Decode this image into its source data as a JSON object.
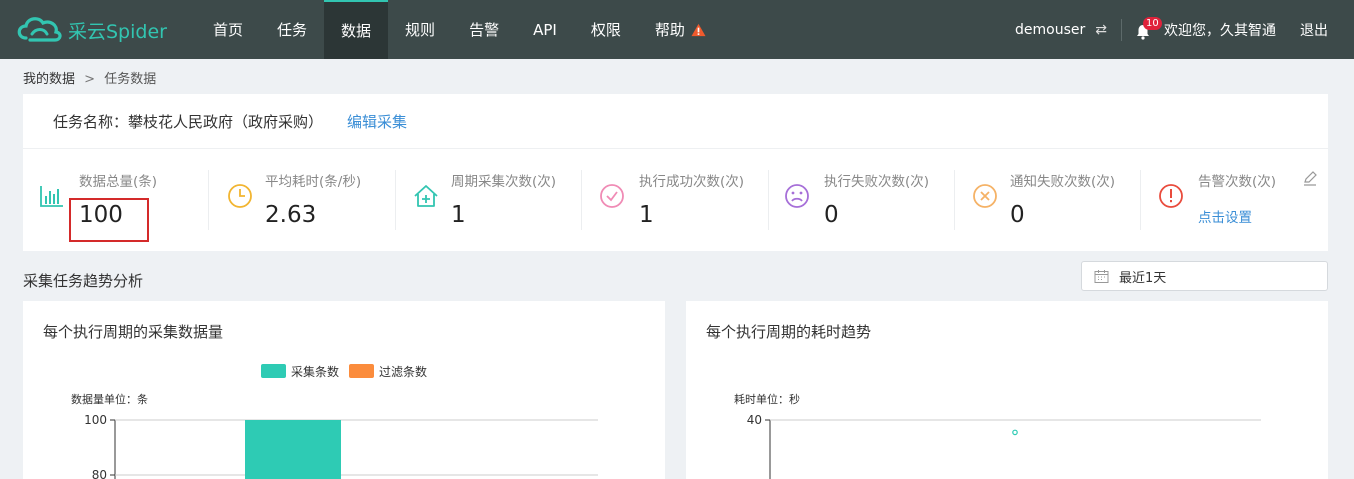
{
  "app": {
    "brand": "采云Spider",
    "colors": {
      "nav_bg": "#3d4a4a",
      "accent": "#32c5b1",
      "link": "#3a8ed6",
      "alert": "#e0223b",
      "warn": "#ef5a2d"
    }
  },
  "nav": {
    "items": [
      {
        "label": "首页",
        "active": false
      },
      {
        "label": "任务",
        "active": false
      },
      {
        "label": "数据",
        "active": true
      },
      {
        "label": "规则",
        "active": false
      },
      {
        "label": "告警",
        "active": false
      },
      {
        "label": "API",
        "active": false
      },
      {
        "label": "权限",
        "active": false
      },
      {
        "label": "帮助",
        "active": false,
        "icon": "warning-icon"
      }
    ]
  },
  "header_right": {
    "username": "demouser",
    "switch_icon": "⇄",
    "notification_count": "10",
    "welcome": "欢迎您，久其智通",
    "logout": "退出"
  },
  "breadcrumb": {
    "parent": "我的数据",
    "separator": ">",
    "current": "任务数据"
  },
  "task": {
    "name_label": "任务名称：攀枝花人民政府（政府采购）",
    "edit_label": "编辑采集"
  },
  "stats": [
    {
      "label": "数据总量(条)",
      "value": "100",
      "icon": "bar-chart-icon",
      "color": "#32c5b1"
    },
    {
      "label": "平均耗时(条/秒)",
      "value": "2.63",
      "icon": "clock-icon",
      "color": "#f2b531"
    },
    {
      "label": "周期采集次数(次)",
      "value": "1",
      "icon": "house-plus-icon",
      "color": "#32c5b1"
    },
    {
      "label": "执行成功次数(次)",
      "value": "1",
      "icon": "check-circle-icon",
      "color": "#f08bb5"
    },
    {
      "label": "执行失败次数(次)",
      "value": "0",
      "icon": "sad-face-icon",
      "color": "#a66fd8"
    },
    {
      "label": "通知失败次数(次)",
      "value": "0",
      "icon": "x-circle-icon",
      "color": "#f5b266"
    },
    {
      "label": "告警次数(次)",
      "value": "",
      "link": "点击设置",
      "icon": "alert-circle-icon",
      "color": "#e94b3c"
    }
  ],
  "trend": {
    "section_title": "采集任务趋势分析",
    "date_range": "最近1天"
  },
  "chart_data": [
    {
      "type": "bar",
      "title": "每个执行周期的采集数据量",
      "ylabel": "数据量单位：条",
      "legend": [
        "采集条数",
        "过滤条数"
      ],
      "legend_placement": "top-center",
      "series": [
        {
          "name": "采集条数",
          "color": "#2ecbb4",
          "values": [
            100
          ]
        },
        {
          "name": "过滤条数",
          "color": "#fb8c3c",
          "values": [
            0
          ]
        }
      ],
      "y_ticks": [
        "100",
        "80"
      ],
      "ylim": [
        0,
        100
      ],
      "grid": true
    },
    {
      "type": "scatter",
      "title": "每个执行周期的耗时趋势",
      "ylabel": "耗时单位：秒",
      "y_ticks": [
        "40"
      ],
      "ylim": [
        0,
        40
      ],
      "points": [
        {
          "y": 38
        }
      ],
      "point_color": "#2ecbb4",
      "grid": true
    }
  ]
}
